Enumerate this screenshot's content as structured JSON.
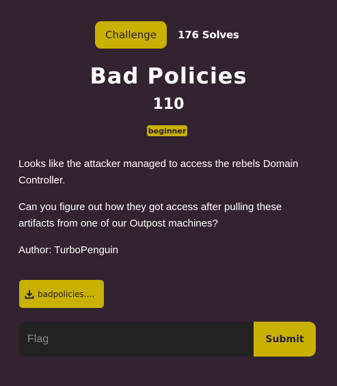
{
  "tabs": {
    "challenge_label": "Challenge",
    "solves_label": "176 Solves"
  },
  "challenge": {
    "title": "Bad Policies",
    "points": "110",
    "tag": "beginner",
    "description": [
      "Looks like the attacker managed to access the rebels Domain Controller.",
      "Can you figure out how they got access after pulling these artifacts from one of our Outpost machines?",
      "Author: TurboPenguin"
    ],
    "file_label": "badpolicies...."
  },
  "flag_form": {
    "placeholder": "Flag",
    "value": "",
    "submit_label": "Submit"
  },
  "colors": {
    "background": "#33222f",
    "accent": "#c8b100",
    "input_bg": "#222222"
  },
  "icons": {
    "download": "download-icon"
  }
}
